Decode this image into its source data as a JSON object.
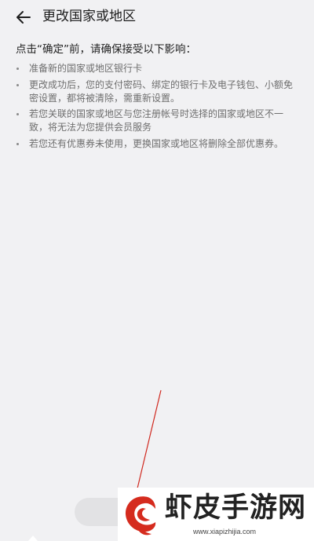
{
  "header": {
    "title": "更改国家或地区",
    "back_icon": "arrow-left-icon"
  },
  "intro": "点击“确定”前，请确保接受以下影响：",
  "notices": [
    "准备新的国家或地区银行卡",
    "更改成功后，您的支付密码、绑定的银行卡及电子钱包、小额免密设置，都将被清除，需重新设置。",
    "若您关联的国家或地区与您注册帐号时选择的国家或地区不一致，将无法为您提供会员服务",
    "若您还有优惠券未使用，更换国家或地区将删除全部优惠券。"
  ],
  "watermark": {
    "title": "虾皮手游网",
    "url": "www.xiapizhijia.com"
  },
  "colors": {
    "background": "#f1f1f3",
    "annotation_arrow": "#d0281e",
    "watermark_red": "#d52b1e"
  }
}
